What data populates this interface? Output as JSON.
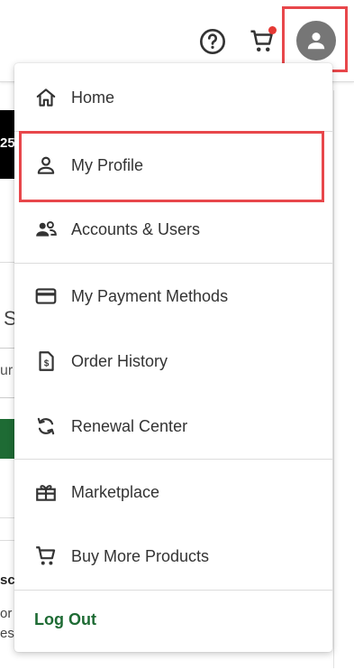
{
  "header": {
    "help_icon": "help-circle-icon",
    "cart_icon": "shopping-cart-icon",
    "avatar_icon": "account-circle-icon"
  },
  "background": {
    "black_banner_text": "25",
    "card_heading_fragment": "S",
    "card_input_fragment": "ur",
    "card2_heading_fragment": "sc",
    "card2_line1_fragment": "or",
    "card2_line2_fragment": "es"
  },
  "menu": {
    "items": [
      {
        "label": "Home",
        "icon": "home-icon"
      },
      {
        "label": "My Profile",
        "icon": "person-icon"
      },
      {
        "label": "Accounts & Users",
        "icon": "users-icon"
      },
      {
        "label": "My Payment Methods",
        "icon": "credit-card-icon"
      },
      {
        "label": "Order History",
        "icon": "receipt-dollar-icon"
      },
      {
        "label": "Renewal Center",
        "icon": "renew-icon"
      },
      {
        "label": "Marketplace",
        "icon": "gift-box-icon"
      },
      {
        "label": "Buy More Products",
        "icon": "shopping-cart-icon"
      }
    ],
    "logout_label": "Log Out"
  },
  "colors": {
    "highlight": "#e8474b",
    "avatar_bg": "#767676",
    "cart_badge": "#e53935",
    "logout_text": "#1e6b34",
    "icon": "#333333"
  }
}
